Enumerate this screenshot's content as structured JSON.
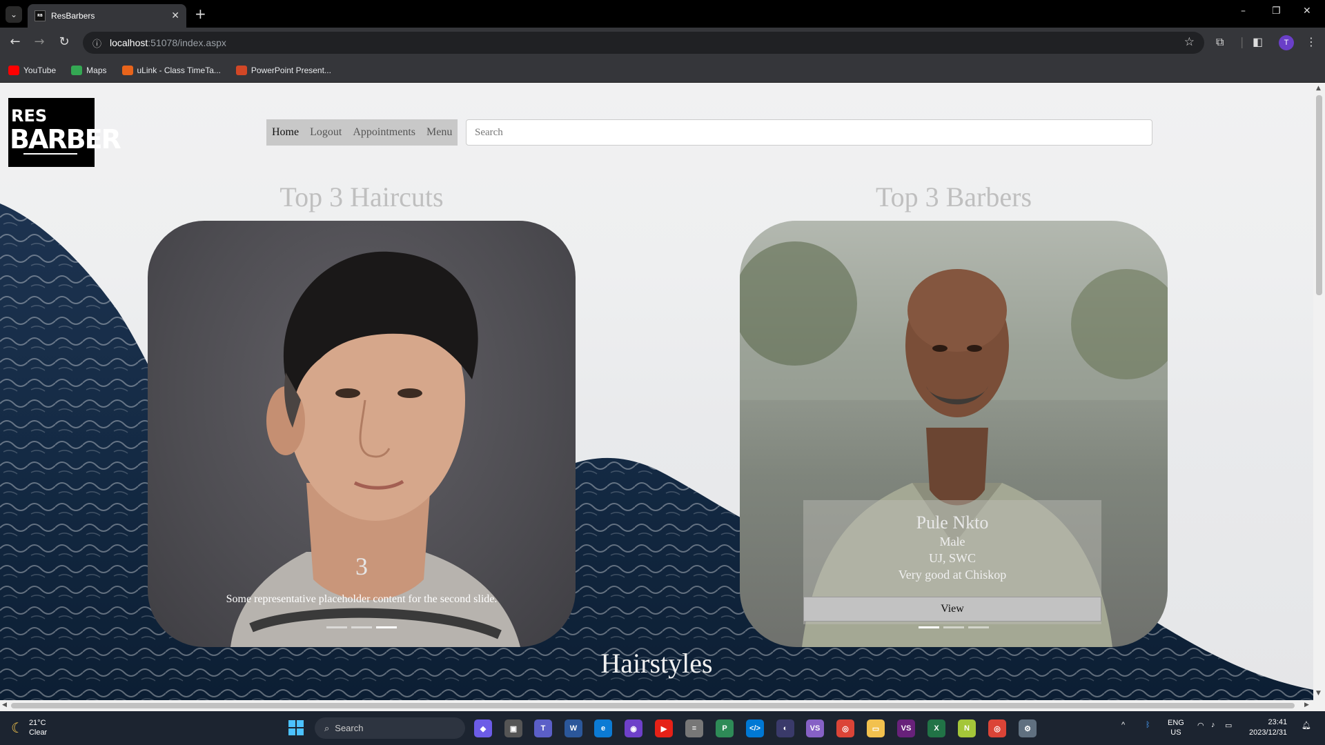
{
  "browser": {
    "tab_title": "ResBarbers",
    "url_host": "localhost",
    "url_rest": ":51078/index.aspx",
    "profile_initial": "T",
    "bookmarks": [
      {
        "label": "YouTube",
        "color": "#ff0000"
      },
      {
        "label": "Maps",
        "color": "#34a853"
      },
      {
        "label": "uLink - Class TimeTa...",
        "color": "#e8641b"
      },
      {
        "label": "PowerPoint Present...",
        "color": "#d24726"
      }
    ]
  },
  "page": {
    "logo": {
      "line1": "RES",
      "line2": "BARBER"
    },
    "nav": {
      "items": [
        "Home",
        "Logout",
        "Appointments",
        "Menu"
      ],
      "search_placeholder": "Search"
    },
    "haircuts": {
      "title": "Top 3 Haircuts",
      "slide_number": "3",
      "caption": "Some representative placeholder content for the second slide.",
      "indicators_total": 3,
      "active_indicator": 3
    },
    "barbers": {
      "title": "Top 3 Barbers",
      "name": "Pule Nkto",
      "gender": "Male",
      "location": "UJ, SWC",
      "skill": "Very good at Chiskop",
      "view_label": "View",
      "indicators_total": 3,
      "active_indicator": 1
    },
    "hairstyles_title": "Hairstyles"
  },
  "taskbar": {
    "temperature": "21°C",
    "condition": "Clear",
    "search_label": "Search",
    "language": "ENG",
    "region": "US",
    "time": "23:41",
    "date": "2023/12/31"
  }
}
